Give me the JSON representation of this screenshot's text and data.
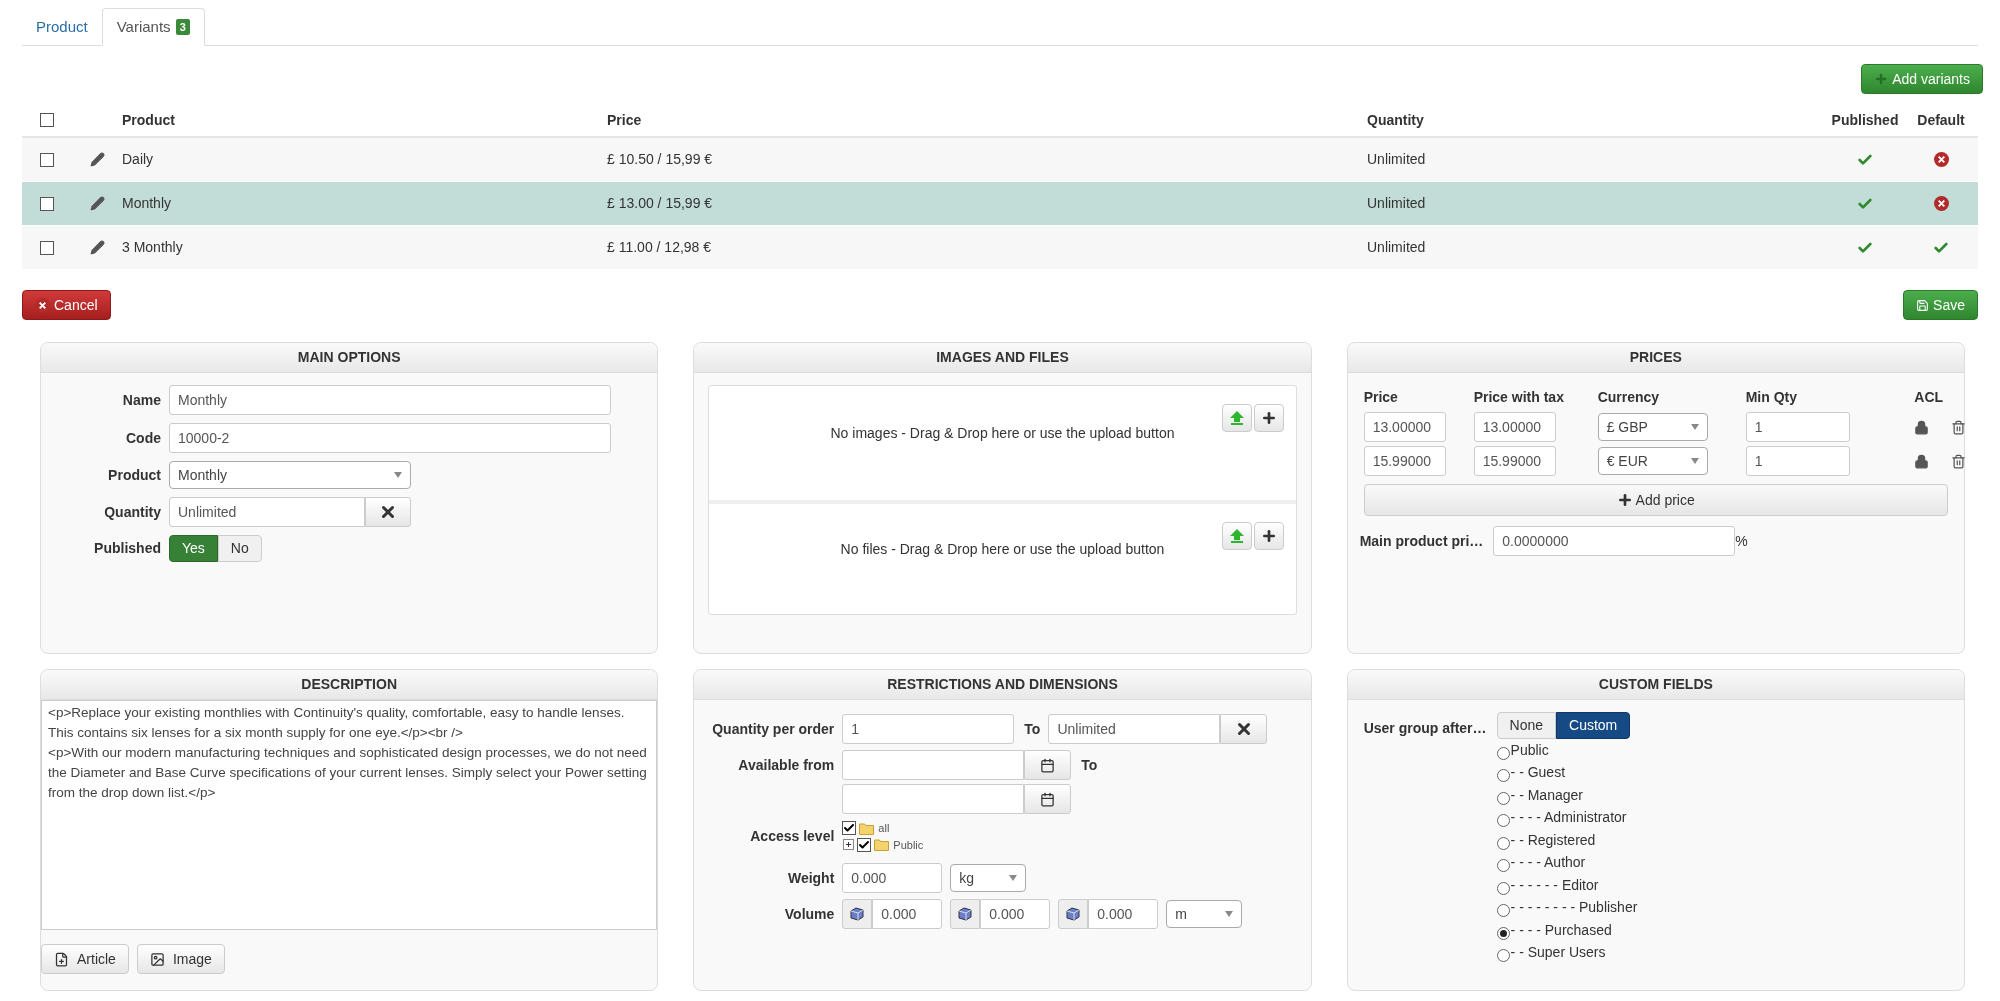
{
  "tabs": [
    {
      "label": "Product",
      "selected": false
    },
    {
      "label": "Variants",
      "selected": true,
      "badge": "3"
    }
  ],
  "add_variants_button": "Add variants",
  "variants_table": {
    "columns": [
      "Product",
      "Price",
      "Quantity",
      "Published",
      "Default"
    ],
    "all_checked": false,
    "rows": [
      {
        "checked": false,
        "selected": false,
        "product": "Daily",
        "price": "£ 10.50 / 15,99 €",
        "quantity": "Unlimited",
        "published": true,
        "default": false
      },
      {
        "checked": false,
        "selected": true,
        "product": "Monthly",
        "price": "£ 13.00 / 15,99 €",
        "quantity": "Unlimited",
        "published": true,
        "default": false
      },
      {
        "checked": false,
        "selected": false,
        "product": "3 Monthly",
        "price": "£ 11.00 / 12,98 €",
        "quantity": "Unlimited",
        "published": true,
        "default": true
      }
    ]
  },
  "cancel_button": "Cancel",
  "save_button": "Save",
  "main_options": {
    "title": "MAIN OPTIONS",
    "name": {
      "label": "Name",
      "value": "Monthly"
    },
    "code": {
      "label": "Code",
      "value": "10000-2"
    },
    "product": {
      "label": "Product",
      "value": "Monthly"
    },
    "quantity": {
      "label": "Quantity",
      "value": "Unlimited"
    },
    "published": {
      "label": "Published",
      "options": [
        {
          "label": "Yes",
          "selected": true
        },
        {
          "label": "No",
          "selected": false
        }
      ]
    }
  },
  "images_and_files": {
    "title": "IMAGES AND FILES",
    "zones": [
      {
        "message": "No images - Drag & Drop here or use the upload button"
      },
      {
        "message": "No files - Drag & Drop here or use the upload button"
      }
    ]
  },
  "prices": {
    "title": "PRICES",
    "columns": [
      "Price",
      "Price with tax",
      "Currency",
      "Min Qty",
      "ACL"
    ],
    "rows": [
      {
        "price": "13.00000",
        "price_with_tax": "13.00000",
        "currency": "£ GBP",
        "min_qty": "1"
      },
      {
        "price": "15.99000",
        "price_with_tax": "15.99000",
        "currency": "€ EUR",
        "min_qty": "1"
      }
    ],
    "add_price_button": "Add price",
    "main_product_price": {
      "label": "Main product pri…",
      "value": "0.0000000",
      "unit": "%"
    }
  },
  "description": {
    "title": "DESCRIPTION",
    "text": "<p>Replace your existing monthlies with Continuity's quality, comfortable, easy to handle lenses. This contains six lenses for a six month supply for one eye.</p><br />\n<p>With our modern manufacturing techniques and sophisticated design processes, we do not need the Diameter and Base Curve specifications of your current lenses. Simply select your Power setting from the drop down list.</p>",
    "buttons": [
      "Article",
      "Image"
    ]
  },
  "restrictions": {
    "title": "RESTRICTIONS AND DIMENSIONS",
    "quantity_per_order": {
      "label": "Quantity per order",
      "from": "1",
      "to_label": "To",
      "to": "Unlimited"
    },
    "available_from": {
      "label": "Available from",
      "to_label": "To"
    },
    "access_level": {
      "label": "Access level",
      "tree": [
        {
          "label": "all",
          "checked": true,
          "children": [
            {
              "label": "Public",
              "checked": true,
              "expanded": false
            }
          ]
        }
      ]
    },
    "weight": {
      "label": "Weight",
      "value": "0.000",
      "unit": "kg"
    },
    "volume": {
      "label": "Volume",
      "values": [
        "0.000",
        "0.000",
        "0.000"
      ],
      "unit": "m"
    }
  },
  "custom_fields": {
    "title": "CUSTOM FIELDS",
    "label": "User group after…",
    "options": [
      {
        "label": "None",
        "selected": false
      },
      {
        "label": "Custom",
        "selected": true
      }
    ],
    "groups": [
      {
        "label": "Public",
        "selected": false
      },
      {
        "label": "- - Guest",
        "selected": false
      },
      {
        "label": "- - Manager",
        "selected": false
      },
      {
        "label": "- - - - Administrator",
        "selected": false
      },
      {
        "label": "- - Registered",
        "selected": false
      },
      {
        "label": "- - - - Author",
        "selected": false
      },
      {
        "label": "- - - - - - Editor",
        "selected": false
      },
      {
        "label": "- - - - - - - - Publisher",
        "selected": false
      },
      {
        "label": "- - - - Purchased",
        "selected": true
      },
      {
        "label": "- - Super Users",
        "selected": false
      }
    ]
  }
}
